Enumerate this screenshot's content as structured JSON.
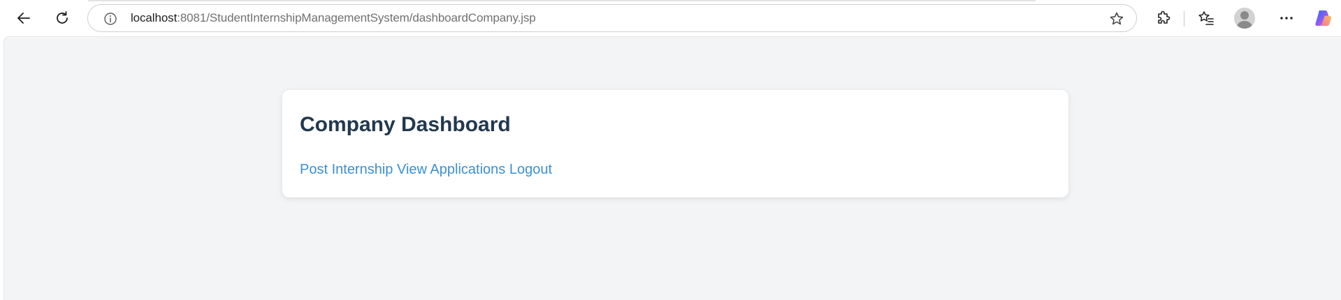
{
  "browser": {
    "url_host": "localhost",
    "url_path": ":8081/StudentInternshipManagementSystem/dashboardCompany.jsp",
    "icons": [
      "back-arrow-icon",
      "refresh-icon",
      "info-icon",
      "star-icon",
      "extensions-icon",
      "favorites-icon",
      "profile-icon",
      "more-icon",
      "copilot-icon"
    ],
    "colors": {
      "copilot_gradient": [
        "#2870ea",
        "#8a5cf6",
        "#f2669a",
        "#f7b544"
      ]
    }
  },
  "page": {
    "title": "Company Dashboard",
    "links": [
      "Post Internship",
      "View Applications",
      "Logout"
    ],
    "colors": {
      "background": "#f3f4f6",
      "title": "#22384f",
      "link": "#3b8fd6"
    }
  }
}
